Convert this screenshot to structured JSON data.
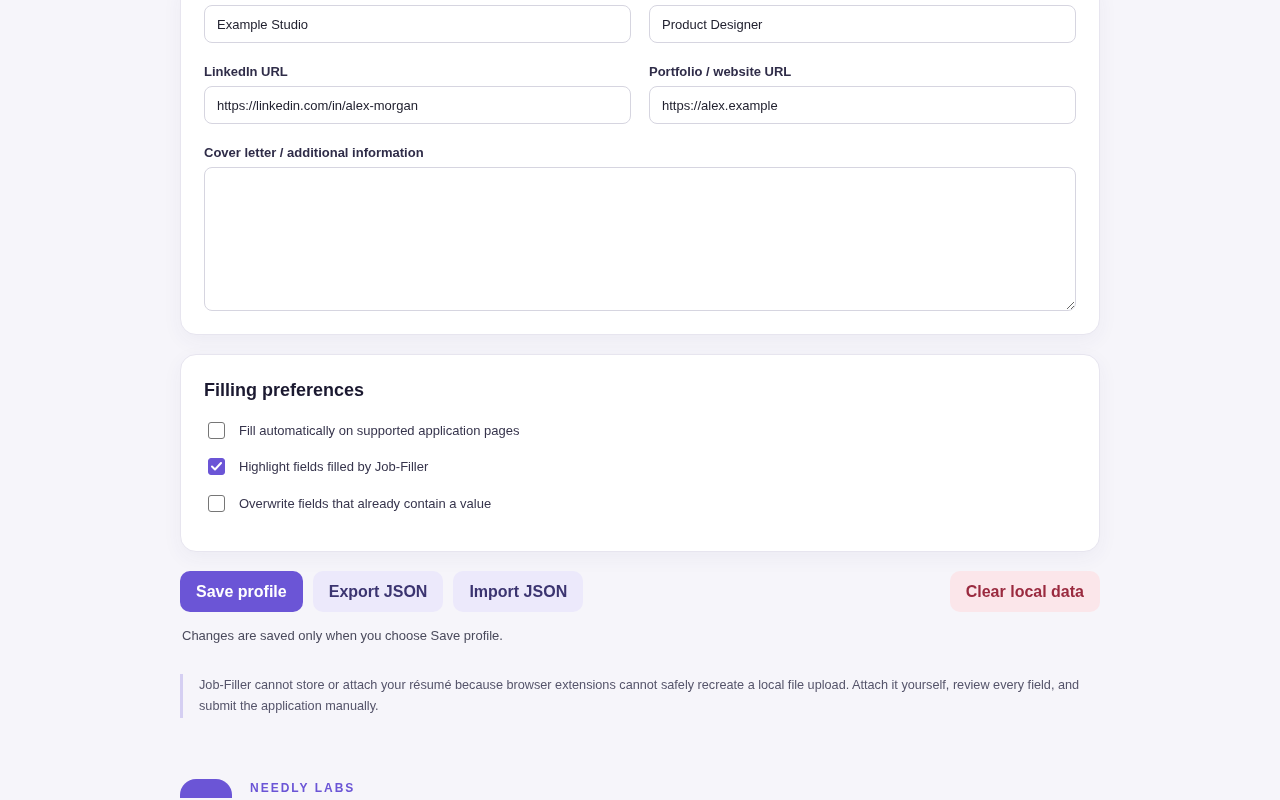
{
  "profile_card": {
    "fields": [
      {
        "kind": "input",
        "value": "Example Studio"
      },
      {
        "kind": "input",
        "value": "Product Designer"
      },
      {
        "kind": "input",
        "label": "LinkedIn URL",
        "value": "https://linkedin.com/in/alex-morgan"
      },
      {
        "kind": "input",
        "label": "Portfolio / website URL",
        "value": "https://alex.example"
      },
      {
        "kind": "textarea",
        "label": "Cover letter / additional information"
      }
    ]
  },
  "preferences": {
    "title": "Filling preferences",
    "options": [
      {
        "label": "Fill automatically on supported application pages",
        "checked": false
      },
      {
        "label": "Highlight fields filled by Job-Filler",
        "checked": true
      },
      {
        "label": "Overwrite fields that already contain a value",
        "checked": false
      }
    ]
  },
  "actions": [
    {
      "kind": "primary",
      "label": "Save profile"
    },
    {
      "kind": "secondary",
      "label": "Export JSON"
    },
    {
      "kind": "secondary",
      "label": "Import JSON"
    },
    {
      "kind": "danger",
      "label": "Clear local data"
    }
  ],
  "save_note": "Changes are saved only when you choose Save profile.",
  "notice": "Job-Filler cannot store or attach your résumé because browser extensions cannot safely recreate a local file upload. Attach it yourself, review every field, and submit the application manually.",
  "footer": {
    "brand": "NEEDLY LABS"
  }
}
